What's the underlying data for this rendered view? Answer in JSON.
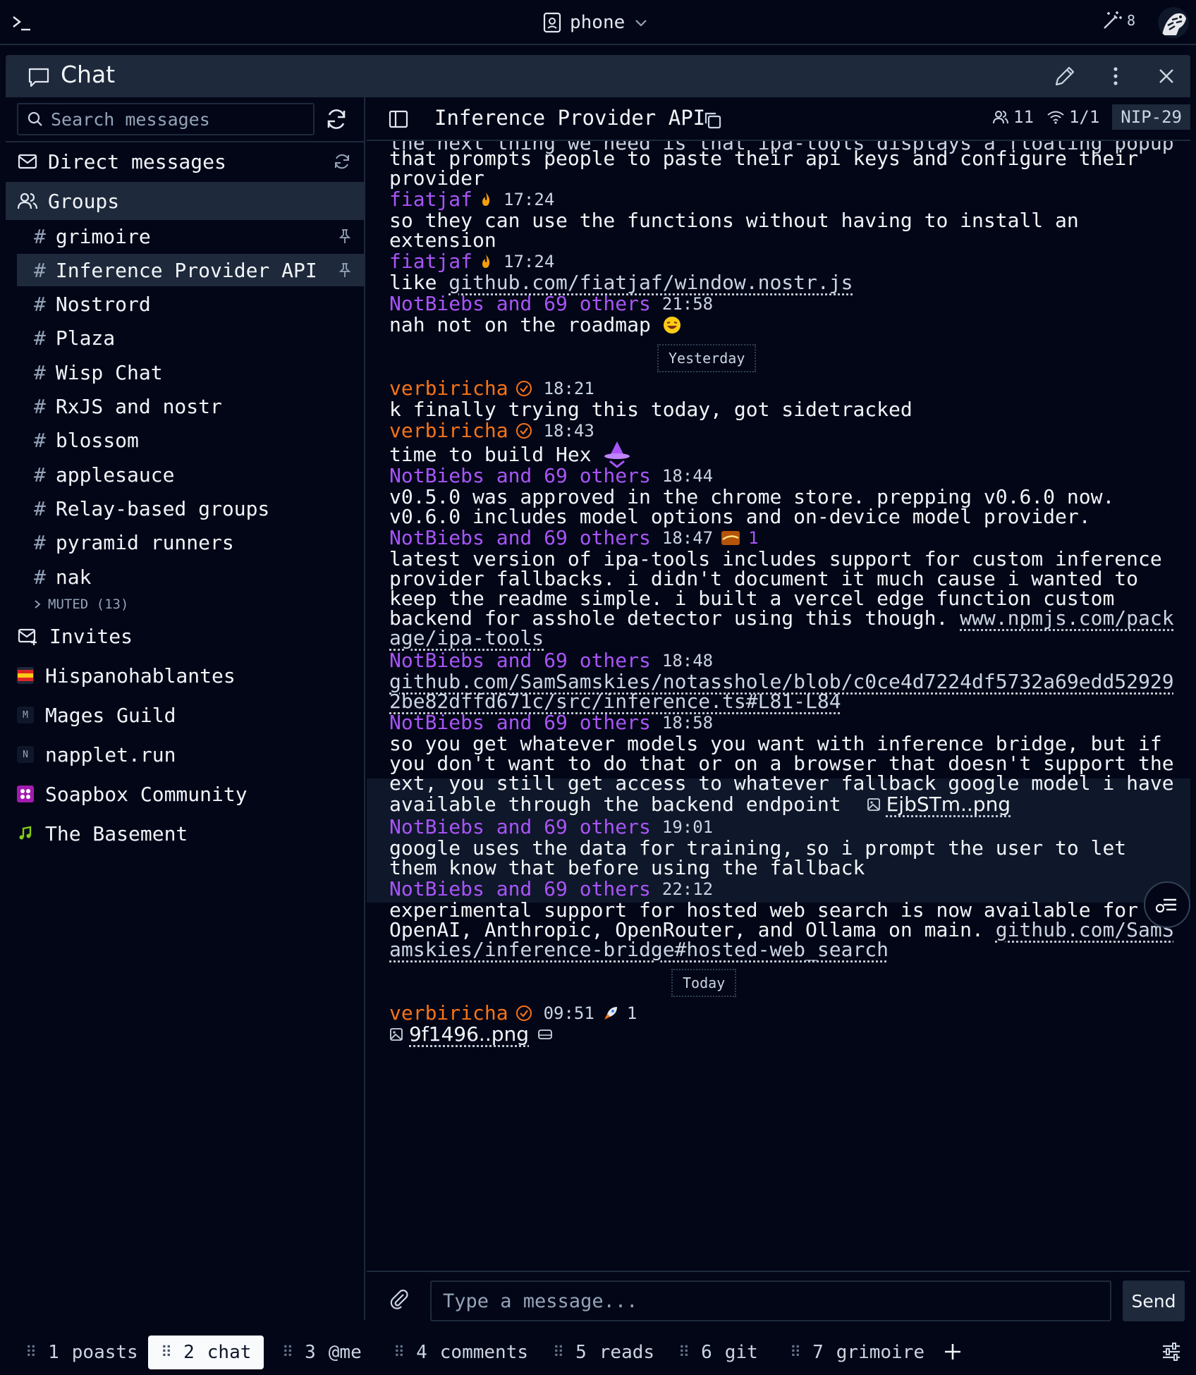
{
  "topbar": {
    "workspace": "phone",
    "wand_count": "8"
  },
  "window": {
    "title": "Chat"
  },
  "sidebar": {
    "search_placeholder": "Search messages",
    "direct_messages": "Direct messages",
    "groups_label": "Groups",
    "groups": [
      {
        "name": "grimoire",
        "pinned": true
      },
      {
        "name": "Inference Provider API",
        "pinned": true
      },
      {
        "name": "Nostrord"
      },
      {
        "name": "Plaza"
      },
      {
        "name": "Wisp Chat"
      },
      {
        "name": "RxJS and nostr"
      },
      {
        "name": "blossom"
      },
      {
        "name": "applesauce"
      },
      {
        "name": "Relay-based groups"
      },
      {
        "name": "pyramid runners"
      },
      {
        "name": "nak"
      }
    ],
    "hash": "#",
    "muted_label": "MUTED (13)",
    "invites": "Invites",
    "communities": [
      {
        "name": "Hispanohablantes",
        "icon": "flag-icon"
      },
      {
        "name": "Mages Guild",
        "icon": "M"
      },
      {
        "name": "napplet.run",
        "icon": "N"
      },
      {
        "name": "Soapbox Community",
        "icon": "soapbox-icon"
      },
      {
        "name": "The Basement",
        "icon": "music-note-icon"
      }
    ]
  },
  "chat": {
    "title": "Inference Provider API",
    "members": "11",
    "relays": "1/1",
    "nip": "NIP-29",
    "messages": {
      "m0_cut": "the next thing we need is that ipa-tools displays a floating popup",
      "m0_l1": "that prompts people to paste their api keys and configure their",
      "m0_l2": "provider",
      "m1_author": "fiatjaf",
      "m1_time": "17:24",
      "m1_l1": "so they can use the functions without having to install an",
      "m1_l2": "extension",
      "m2_author": "fiatjaf",
      "m2_time": "17:24",
      "m2_prefix": "like ",
      "m2_link": "github.com/fiatjaf/window.nostr.js",
      "m3_author": "NotBiebs and 69 others",
      "m3_time": "21:58",
      "m3_l1": "nah not on the roadmap",
      "sep_yesterday": "Yesterday",
      "m4_author": "verbiricha",
      "m4_time": "18:21",
      "m4_l1": "k finally trying this today, got sidetracked",
      "m5_author": "verbiricha",
      "m5_time": "18:43",
      "m5_l1": "time to build Hex",
      "m6_author": "NotBiebs and 69 others",
      "m6_time": "18:44",
      "m6_l1": "v0.5.0 was approved in the chrome store. prepping v0.6.0 now.",
      "m6_l2": "v0.6.0 includes model options and on-device model provider.",
      "m7_author": "NotBiebs and 69 others",
      "m7_time": "18:47",
      "m7_reaction": "1",
      "m7_l1": "latest version of ipa-tools includes support for custom inference",
      "m7_l2": "provider fallbacks. i didn't document it much cause i wanted to",
      "m7_l3": "keep the readme simple. i built a vercel edge function custom",
      "m7_l4": "backend for asshole detector using this though. ",
      "m7_link1": "www.npmjs.com/pack",
      "m7_link2": "age/ipa-tools",
      "m8_author": "NotBiebs and 69 others",
      "m8_time": "18:48",
      "m8_link1": "github.com/SamSamskies/notasshole/blob/c0ce4d7224df5732a69edd52929",
      "m8_link2": "2be82dffd671c/src/inference.ts#L81-L84",
      "m9_author": "NotBiebs and 69 others",
      "m9_time": "18:58",
      "m9_l1": "so you get whatever models you want with inference bridge, but if",
      "m9_l2": "you don't want to do that or on a browser that doesn't support the",
      "m9_l3": "ext, you still get access to whatever fallback google model i have",
      "m9_l4": "available through the backend endpoint",
      "m9_file": "EjbSTm..png",
      "m10_author": "NotBiebs and 69 others",
      "m10_time": "19:01",
      "m10_l1": "google uses the data for training, so i prompt the user to let",
      "m10_l2": "them know that before using the fallback",
      "m11_author": "NotBiebs and 69 others",
      "m11_time": "22:12",
      "m11_l1": "experimental support for hosted web search is now available for",
      "m11_l2": "OpenAI, Anthropic, OpenRouter, and Ollama on main. ",
      "m11_link1": "github.com/SamS",
      "m11_link2": "amskies/inference-bridge#hosted-web_search",
      "sep_today": "Today",
      "m12_author": "verbiricha",
      "m12_time": "09:51",
      "m12_reaction": "1",
      "m12_file": "9f1496..png"
    },
    "composer_placeholder": "Type a message...",
    "send_label": "Send"
  },
  "tabs": [
    {
      "num": "1",
      "label": "poasts"
    },
    {
      "num": "2",
      "label": "chat",
      "active": true
    },
    {
      "num": "3",
      "label": "@me"
    },
    {
      "num": "4",
      "label": "comments"
    },
    {
      "num": "5",
      "label": "reads"
    },
    {
      "num": "6",
      "label": "git"
    },
    {
      "num": "7",
      "label": "grimoire"
    }
  ],
  "colors": {
    "background": "#020617",
    "panel_header": "#1e293b",
    "author_purple": "#a855f7",
    "author_orange": "#f97316"
  }
}
